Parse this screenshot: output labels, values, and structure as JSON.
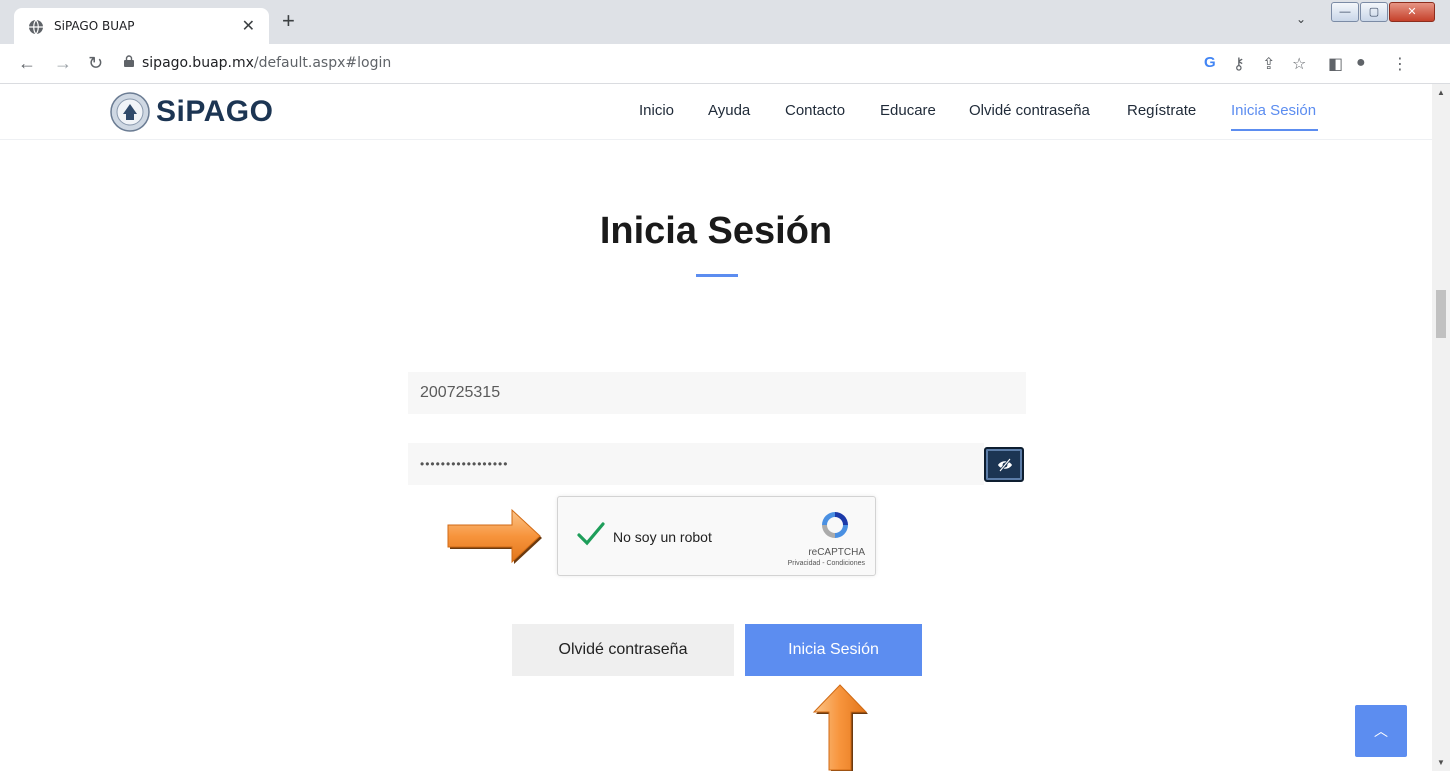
{
  "browser": {
    "tab_title": "SiPAGO BUAP",
    "url_host": "sipago.buap.mx",
    "url_path": "/default.aspx#login",
    "window_buttons": [
      "—",
      "▢",
      "✕"
    ]
  },
  "site": {
    "brand": "SiPAGO",
    "nav": [
      {
        "label": "Inicio"
      },
      {
        "label": "Ayuda"
      },
      {
        "label": "Contacto"
      },
      {
        "label": "Educare"
      },
      {
        "label": "Olvidé contraseña"
      },
      {
        "label": "Regístrate"
      },
      {
        "label": "Inicia Sesión",
        "active": true
      }
    ]
  },
  "login": {
    "heading": "Inicia Sesión",
    "user_value": "200725315",
    "password_value": "•••••••••••••••••",
    "captcha": {
      "label": "No soy un robot",
      "brand": "reCAPTCHA",
      "terms": "Privacidad - Condiciones",
      "checked": true
    },
    "forgot_button": "Olvidé contraseña",
    "login_button": "Inicia Sesión"
  },
  "colors": {
    "accent": "#5c8df0",
    "brand_dark": "#1c3553",
    "arrow_orange": "#f7943c",
    "check_green": "#1e9e5a"
  },
  "icons": {
    "back_to_top": "chevron-up-icon",
    "password_toggle": "eye-slash-icon"
  }
}
